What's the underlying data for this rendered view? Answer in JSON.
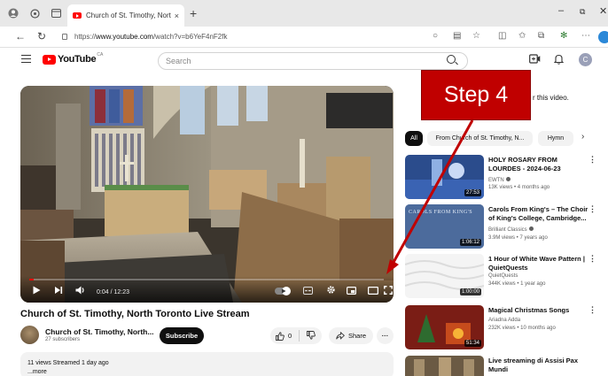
{
  "browser": {
    "tab_title": "Church of St. Timothy, North Toro",
    "tab_close": "×",
    "new_tab": "+",
    "url_prefix": "https://",
    "url_host": "www.youtube.com",
    "url_path": "/watch?v=b6YeF4nF2fk"
  },
  "youtube": {
    "logo_text": "YouTube",
    "logo_country": "CA",
    "search_placeholder": "Search",
    "avatar_letter": "C"
  },
  "player": {
    "time": "0:04 / 12:23",
    "progress_fraction": 0.013
  },
  "video": {
    "title": "Church of St. Timothy, North Toronto Live Stream",
    "channel": "Church of St. Timothy, North...",
    "subscribers": "27 subscribers",
    "subscribe_label": "Subscribe",
    "like_count": "0",
    "share_label": "Share",
    "more_label": "···",
    "views_line": "11 views  Streamed 1 day ago",
    "more_link": "...more"
  },
  "sidebar": {
    "partial_text": "r this video.",
    "chips": [
      "All",
      "From Church of St. Timothy, N...",
      "Hymn"
    ],
    "chip_next": "›",
    "recommendations": [
      {
        "title": "HOLY ROSARY FROM LOURDES - 2024-06-23",
        "channel": "EWTN",
        "verified": true,
        "meta": "13K views • 4 months ago",
        "duration": "27:53"
      },
      {
        "title": "Carols From King's – The Choir of King's College, Cambridge...",
        "channel": "Brilliant Classics",
        "verified": true,
        "meta": "3.9M views • 7 years ago",
        "duration": "1:06:12",
        "thumb_text": "CAROLS FROM KING'S"
      },
      {
        "title": "1 Hour of White Wave Pattern | QuietQuests",
        "channel": "",
        "verified": false,
        "meta": "344K views • 1 year ago",
        "duration": "1:00:00"
      },
      {
        "title": "Magical Christmas Songs",
        "channel": "Ariadna Adda",
        "verified": false,
        "meta": "232K views • 10 months ago",
        "duration": "51:34"
      },
      {
        "title": "Live streaming di Assisi Pax Mundi",
        "channel": "",
        "verified": false,
        "meta": "",
        "duration": ""
      }
    ],
    "second_rec_channel_alt": "QuietQuests"
  },
  "annotation": {
    "label": "Step 4",
    "color": "#c00000"
  }
}
